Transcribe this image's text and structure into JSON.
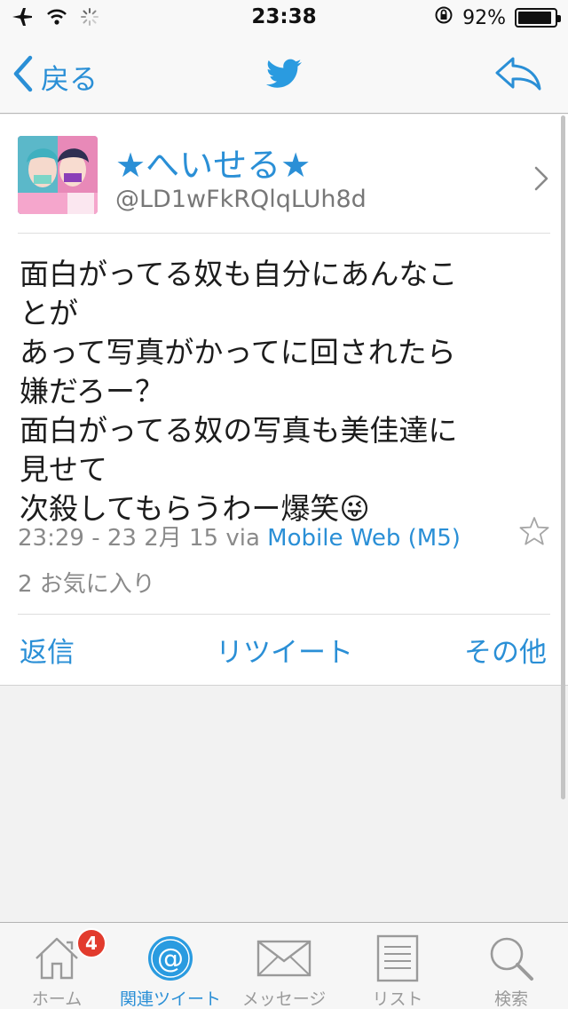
{
  "status_bar": {
    "time": "23:38",
    "battery_percent": "92%",
    "battery_level": 0.92
  },
  "nav": {
    "back_label": "戻る",
    "icons": [
      "chevron-left-icon",
      "twitter-bird-icon",
      "reply-arrow-icon"
    ]
  },
  "tweet": {
    "display_name": "★へいせる★",
    "handle": "@LD1wFkRQlqLUh8d",
    "text": "面白がってる奴も自分にあんなこ\nとが\nあって写真がかってに回されたら\n嫌だろー？\n面白がってる奴の写真も美佳達に\n見せて\n次殺してもらうわー爆笑😜",
    "timestamp": "23:29 - 23 2月 15 via ",
    "source": "Mobile Web (M5)",
    "favorites": "2 お気に入り"
  },
  "actions": {
    "reply": "返信",
    "retweet": "リツイート",
    "more": "その他"
  },
  "tabs": [
    {
      "label": "ホーム",
      "icon": "home-icon",
      "badge": "4"
    },
    {
      "label": "関連ツイート",
      "icon": "at-mention-icon",
      "active": true
    },
    {
      "label": "メッセージ",
      "icon": "envelope-icon"
    },
    {
      "label": "リスト",
      "icon": "list-icon"
    },
    {
      "label": "検索",
      "icon": "search-icon"
    }
  ],
  "colors": {
    "accent": "#2a8fd6",
    "badge": "#e23b2d"
  }
}
